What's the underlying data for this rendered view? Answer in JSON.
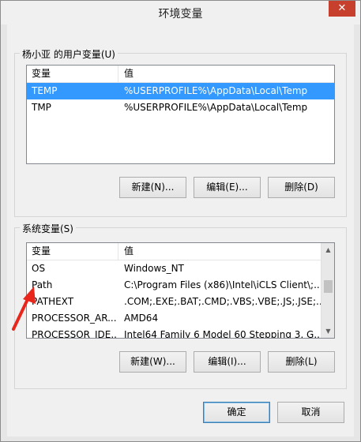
{
  "window": {
    "title": "环境变量",
    "close_glyph": "✕"
  },
  "user_vars": {
    "legend": "杨小亚 的用户变量(U)",
    "columns": [
      "变量",
      "值"
    ],
    "rows": [
      {
        "name": "TEMP",
        "value": "%USERPROFILE%\\AppData\\Local\\Temp",
        "selected": true
      },
      {
        "name": "TMP",
        "value": "%USERPROFILE%\\AppData\\Local\\Temp",
        "selected": false
      }
    ],
    "buttons": {
      "new": "新建(N)...",
      "edit": "编辑(E)...",
      "delete": "删除(D)"
    }
  },
  "system_vars": {
    "legend": "系统变量(S)",
    "columns": [
      "变量",
      "值"
    ],
    "rows": [
      {
        "name": "OS",
        "value": "Windows_NT"
      },
      {
        "name": "Path",
        "value": "C:\\Program Files (x86)\\Intel\\iCLS Client\\;..."
      },
      {
        "name": "PATHEXT",
        "value": ".COM;.EXE;.BAT;.CMD;.VBS;.VBE;.JS;.JSE;...."
      },
      {
        "name": "PROCESSOR_AR...",
        "value": "AMD64"
      },
      {
        "name": "PROCESSOR_IDE...",
        "value": "Intel64 Family 6 Model 60 Stepping 3, G..."
      }
    ],
    "buttons": {
      "new": "新建(W)...",
      "edit": "编辑(I)...",
      "delete": "删除(L)"
    }
  },
  "dialog_buttons": {
    "ok": "确定",
    "cancel": "取消"
  },
  "colors": {
    "selection": "#3399ff",
    "annotation_arrow": "#e8261c",
    "close_button": "#c7402d"
  },
  "icons": {
    "scroll_up": "▲",
    "scroll_down": "▼"
  }
}
